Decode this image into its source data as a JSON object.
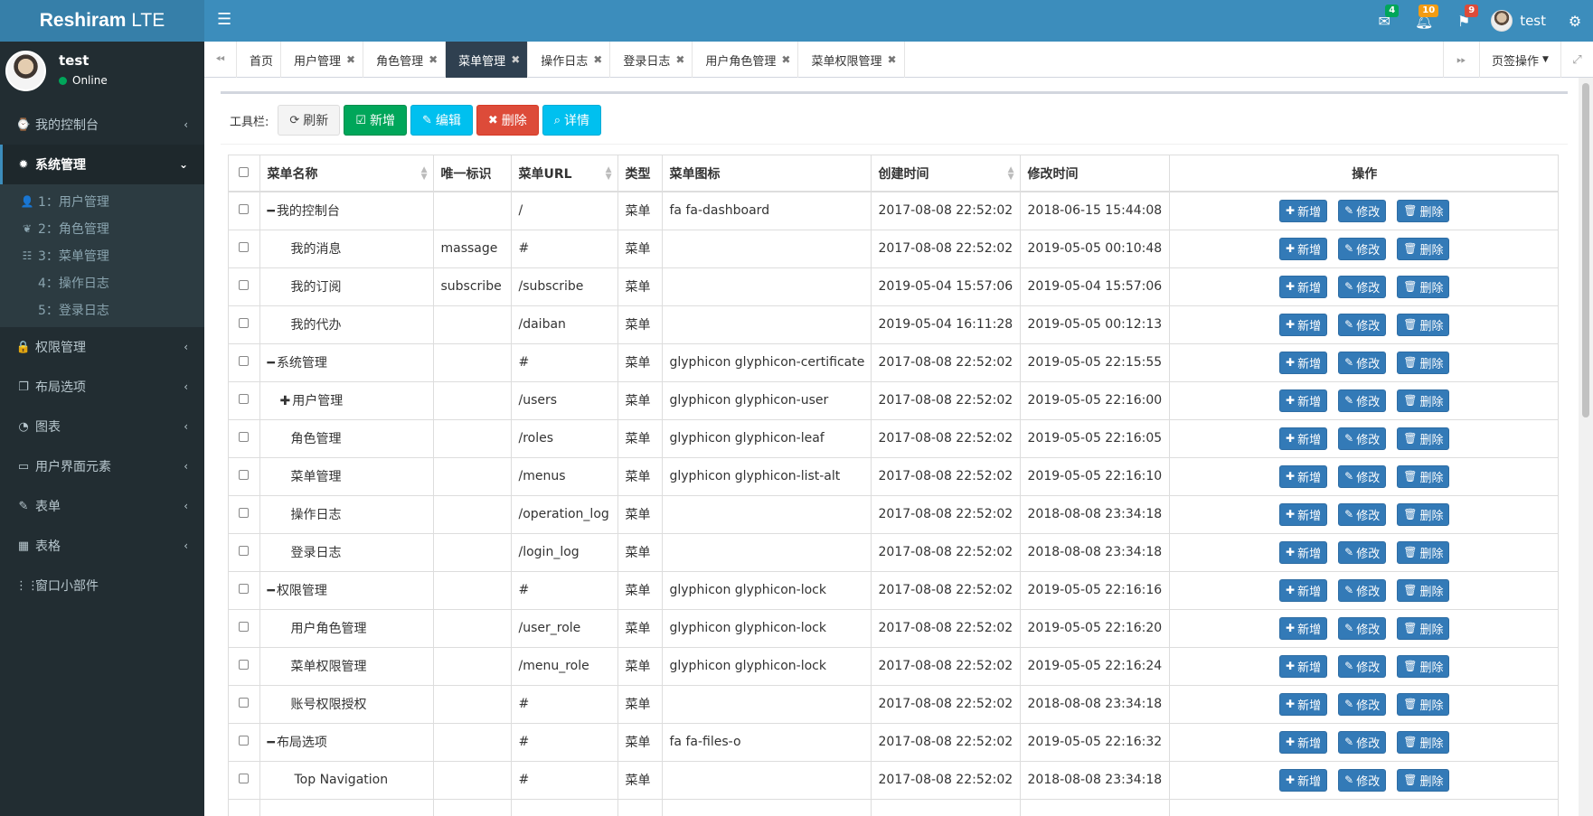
{
  "logo": {
    "bold": "Reshiram",
    "light": " LTE"
  },
  "navbar": {
    "toggle_icon": "☰",
    "badges": {
      "messages": "4",
      "notifications": "10",
      "flags": "9"
    },
    "user_name": "test"
  },
  "sidebar": {
    "user": {
      "name": "test",
      "status": "Online"
    },
    "items": [
      {
        "icon": "⌚",
        "label": "我的控制台",
        "chevron": "‹"
      },
      {
        "icon": "✹",
        "label": "系统管理",
        "chevron": "⌄"
      },
      {
        "icon": "🔒",
        "label": "权限管理",
        "chevron": "‹"
      },
      {
        "icon": "❐",
        "label": "布局选项",
        "chevron": "‹"
      },
      {
        "icon": "◔",
        "label": "图表",
        "chevron": "‹"
      },
      {
        "icon": "▭",
        "label": "用户界面元素",
        "chevron": "‹"
      },
      {
        "icon": "✎",
        "label": "表单",
        "chevron": "‹"
      },
      {
        "icon": "▦",
        "label": "表格",
        "chevron": "‹"
      },
      {
        "icon": "⋮⋮",
        "label": "窗口小部件"
      }
    ],
    "submenu": [
      {
        "icon": "👤",
        "label": "1：用户管理"
      },
      {
        "icon": "❦",
        "label": "2：角色管理"
      },
      {
        "icon": "☷",
        "label": "3：菜单管理"
      },
      {
        "icon": "",
        "label": "4：操作日志"
      },
      {
        "icon": "",
        "label": "5：登录日志"
      }
    ]
  },
  "tabs": {
    "items": [
      "首页",
      "用户管理",
      "角色管理",
      "菜单管理",
      "操作日志",
      "登录日志",
      "用户角色管理",
      "菜单权限管理"
    ],
    "page_ops": "页签操作"
  },
  "toolbar": {
    "label": "工具栏:",
    "refresh": "刷新",
    "add": "新增",
    "edit": "编辑",
    "delete": "删除",
    "detail": "详情"
  },
  "table": {
    "headers": [
      "菜单名称",
      "唯一标识",
      "菜单URL",
      "类型",
      "菜单图标",
      "创建时间",
      "修改时间",
      "操作"
    ],
    "row_actions": {
      "add": "新增",
      "edit": "修改",
      "delete": "删除"
    },
    "rows": [
      {
        "toggle": "━",
        "name": "我的控制台",
        "key": "",
        "url": "/",
        "type": "菜单",
        "icon": "fa fa-dashboard",
        "created": "2017-08-08 22:52:02",
        "modified": "2018-06-15 15:44:08",
        "level": 0
      },
      {
        "toggle": "",
        "name": "我的消息",
        "key": "massage",
        "url": "#",
        "type": "菜单",
        "icon": "",
        "created": "2017-08-08 22:52:02",
        "modified": "2019-05-05 00:10:48",
        "level": 1
      },
      {
        "toggle": "",
        "name": "我的订阅",
        "key": "subscribe",
        "url": "/subscribe",
        "type": "菜单",
        "icon": "",
        "created": "2019-05-04 15:57:06",
        "modified": "2019-05-04 15:57:06",
        "level": 1
      },
      {
        "toggle": "",
        "name": "我的代办",
        "key": "",
        "url": "/daiban",
        "type": "菜单",
        "icon": "",
        "created": "2019-05-04 16:11:28",
        "modified": "2019-05-05 00:12:13",
        "level": 1
      },
      {
        "toggle": "━",
        "name": "系统管理",
        "key": "",
        "url": "#",
        "type": "菜单",
        "icon": "glyphicon glyphicon-certificate",
        "created": "2017-08-08 22:52:02",
        "modified": "2019-05-05 22:15:55",
        "level": 0
      },
      {
        "toggle": "✚",
        "name": "用户管理",
        "key": "",
        "url": "/users",
        "type": "菜单",
        "icon": "glyphicon glyphicon-user",
        "created": "2017-08-08 22:52:02",
        "modified": "2019-05-05 22:16:00",
        "level": 0.6
      },
      {
        "toggle": "",
        "name": "角色管理",
        "key": "",
        "url": "/roles",
        "type": "菜单",
        "icon": "glyphicon glyphicon-leaf",
        "created": "2017-08-08 22:52:02",
        "modified": "2019-05-05 22:16:05",
        "level": 1
      },
      {
        "toggle": "",
        "name": "菜单管理",
        "key": "",
        "url": "/menus",
        "type": "菜单",
        "icon": "glyphicon glyphicon-list-alt",
        "created": "2017-08-08 22:52:02",
        "modified": "2019-05-05 22:16:10",
        "level": 1
      },
      {
        "toggle": "",
        "name": "操作日志",
        "key": "",
        "url": "/operation_log",
        "type": "菜单",
        "icon": "",
        "created": "2017-08-08 22:52:02",
        "modified": "2018-08-08 23:34:18",
        "level": 1
      },
      {
        "toggle": "",
        "name": "登录日志",
        "key": "",
        "url": "/login_log",
        "type": "菜单",
        "icon": "",
        "created": "2017-08-08 22:52:02",
        "modified": "2018-08-08 23:34:18",
        "level": 1
      },
      {
        "toggle": "━",
        "name": "权限管理",
        "key": "",
        "url": "#",
        "type": "菜单",
        "icon": "glyphicon glyphicon-lock",
        "created": "2017-08-08 22:52:02",
        "modified": "2019-05-05 22:16:16",
        "level": 0
      },
      {
        "toggle": "",
        "name": "用户角色管理",
        "key": "",
        "url": "/user_role",
        "type": "菜单",
        "icon": "glyphicon glyphicon-lock",
        "created": "2017-08-08 22:52:02",
        "modified": "2019-05-05 22:16:20",
        "level": 1
      },
      {
        "toggle": "",
        "name": "菜单权限管理",
        "key": "",
        "url": "/menu_role",
        "type": "菜单",
        "icon": "glyphicon glyphicon-lock",
        "created": "2017-08-08 22:52:02",
        "modified": "2019-05-05 22:16:24",
        "level": 1
      },
      {
        "toggle": "",
        "name": "账号权限授权",
        "key": "",
        "url": "#",
        "type": "菜单",
        "icon": "",
        "created": "2017-08-08 22:52:02",
        "modified": "2018-08-08 23:34:18",
        "level": 1
      },
      {
        "toggle": "━",
        "name": "布局选项",
        "key": "",
        "url": "#",
        "type": "菜单",
        "icon": "fa fa-files-o",
        "created": "2017-08-08 22:52:02",
        "modified": "2019-05-05 22:16:32",
        "level": 0
      },
      {
        "toggle": "",
        "name": "Top Navigation",
        "key": "",
        "url": "#",
        "type": "菜单",
        "icon": "",
        "created": "2017-08-08 22:52:02",
        "modified": "2018-08-08 23:34:18",
        "level": 1.1
      },
      {
        "toggle": "",
        "name": "",
        "key": "",
        "url": "",
        "type": "",
        "icon": "",
        "created": "",
        "modified": "",
        "level": 1
      }
    ]
  },
  "colors": {
    "header": "#3c8dbc",
    "logo": "#367fa9",
    "sidebar": "#222d32",
    "active_tab": "#2f4050",
    "row_button": "#337ab7"
  }
}
